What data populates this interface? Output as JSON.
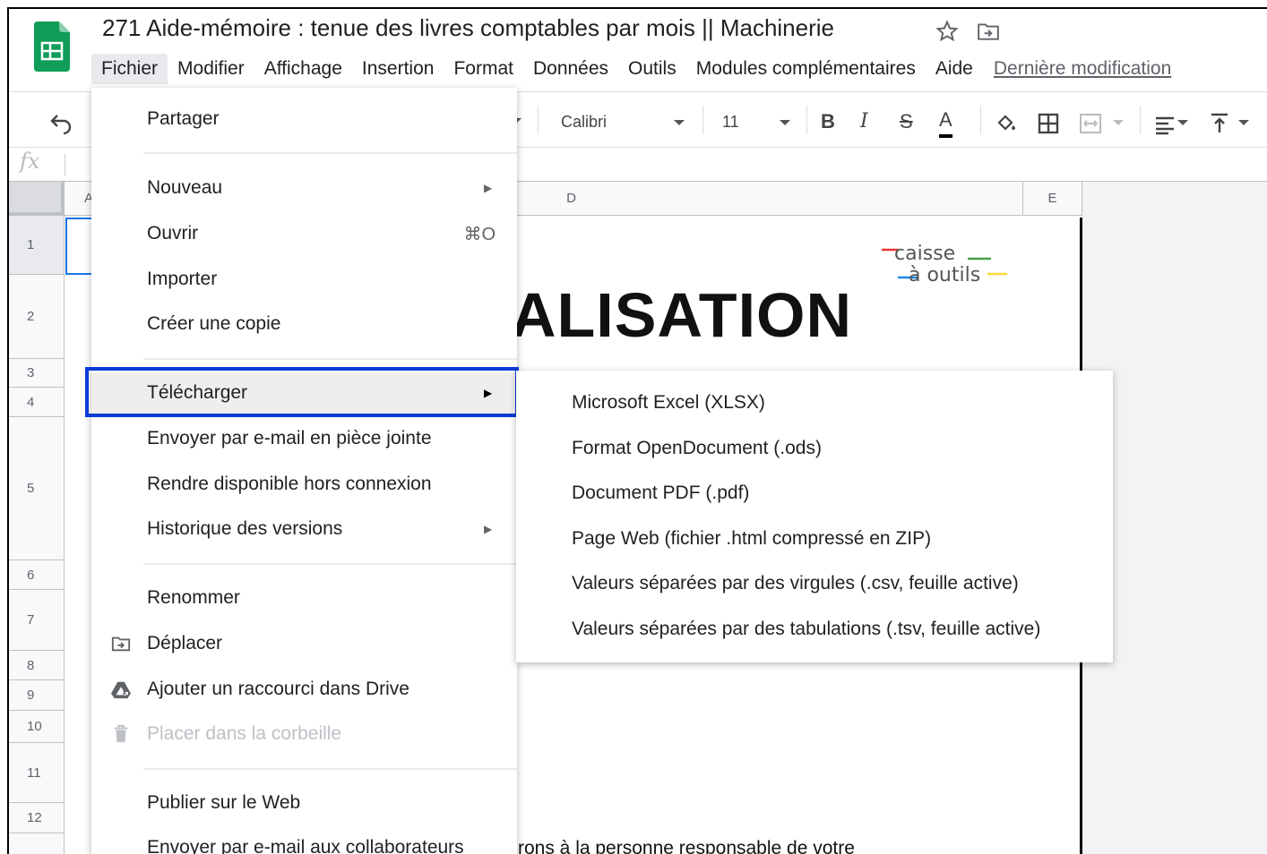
{
  "app": {
    "title": "271 Aide-mémoire : tenue des livres comptables par mois || Machinerie"
  },
  "menubar": {
    "items": [
      "Fichier",
      "Modifier",
      "Affichage",
      "Insertion",
      "Format",
      "Données",
      "Outils",
      "Modules complémentaires",
      "Aide"
    ],
    "last_edit": "Dernière modification"
  },
  "toolbar": {
    "font": "Calibri",
    "font_size": "11",
    "bold": "B",
    "italic": "I",
    "strike": "S",
    "text_color": "A"
  },
  "formula_bar": {
    "fx": "fx"
  },
  "grid": {
    "columns": [
      "A",
      "D",
      "E"
    ],
    "rows": [
      "1",
      "2",
      "3",
      "4",
      "5",
      "6",
      "7",
      "8",
      "9",
      "10",
      "11",
      "12"
    ],
    "title_fragment": "ALISATION",
    "bottom_text": "rons à la personne responsable de votre",
    "brand_line1": "caisse",
    "brand_line2": "à outils"
  },
  "file_menu": {
    "share": "Partager",
    "new": "Nouveau",
    "open": "Ouvrir",
    "open_shortcut": "⌘O",
    "import": "Importer",
    "copy": "Créer une copie",
    "download": "Télécharger",
    "email_attachment": "Envoyer par e-mail en pièce jointe",
    "offline": "Rendre disponible hors connexion",
    "history": "Historique des versions",
    "rename": "Renommer",
    "move": "Déplacer",
    "shortcut_drive": "Ajouter un raccourci dans Drive",
    "trash": "Placer dans la corbeille",
    "publish": "Publier sur le Web",
    "email_collab": "Envoyer par e-mail aux collaborateurs"
  },
  "download_submenu": {
    "items": [
      "Microsoft Excel (XLSX)",
      "Format OpenDocument (.ods)",
      "Document PDF (.pdf)",
      "Page Web (fichier .html compressé en ZIP)",
      "Valeurs séparées par des virgules (.csv, feuille active)",
      "Valeurs séparées par des tabulations (.tsv, feuille active)"
    ]
  },
  "colors": {
    "sheets_green": "#0f9d58",
    "highlight_border": "#0a3bd6",
    "selection": "#1a73e8"
  }
}
